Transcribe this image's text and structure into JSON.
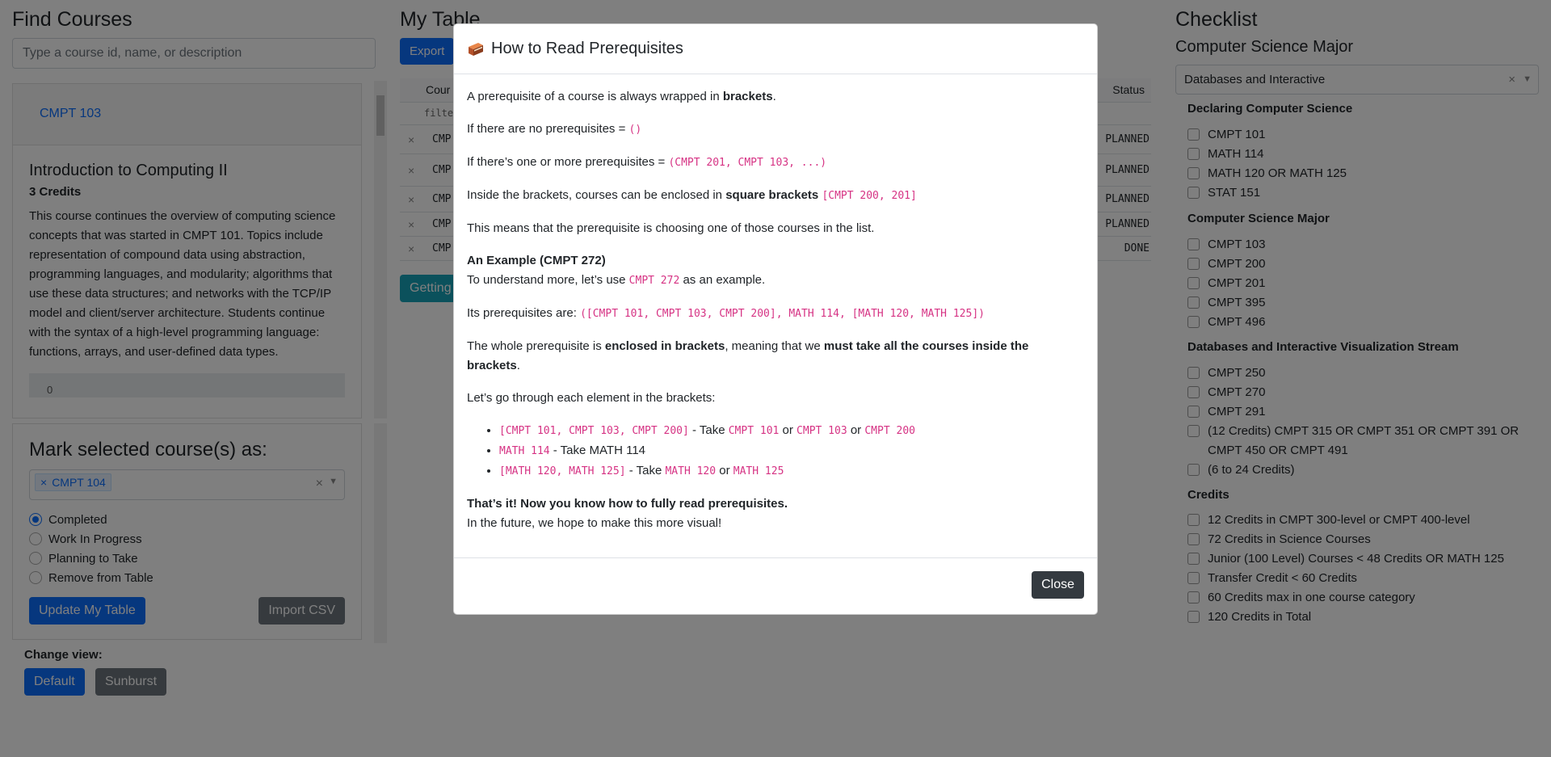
{
  "find_courses": {
    "title": "Find Courses",
    "search_placeholder": "Type a course id, name, or description",
    "course_link": "CMPT 103",
    "course_name": "Introduction to Computing II",
    "course_credits": "3 Credits",
    "course_description": "This course continues the overview of computing science concepts that was started in CMPT 101. Topics include representation of compound data using abstraction, programming languages, and modularity; algorithms that use these data structures; and networks with the TCP/IP model and client/server architecture. Students continue with the syntax of a high-level programming language: functions, arrays, and user-defined data types.",
    "course_footer_value": "0"
  },
  "mark_panel": {
    "title": "Mark selected course(s) as:",
    "chip": "CMPT 104",
    "chip_remove": "×",
    "clear": "×",
    "options": [
      "Completed",
      "Work In Progress",
      "Planning to Take",
      "Remove from Table"
    ],
    "selected_index": 0,
    "update_label": "Update My Table",
    "import_label": "Import CSV"
  },
  "change_view": {
    "label": "Change view:",
    "default_label": "Default",
    "sunburst_label": "Sunburst"
  },
  "my_table": {
    "title": "My Table",
    "export_label": "Export",
    "col_course": "Cour",
    "col_status": "Status",
    "filter_text": "filte",
    "row_remove": "×",
    "rows": [
      {
        "course": "CMP",
        "status": "PLANNED"
      },
      {
        "course": "CMP",
        "status": "PLANNED"
      },
      {
        "course": "CMP",
        "status": "PLANNED"
      },
      {
        "course": "CMP",
        "status": "PLANNED"
      },
      {
        "course": "CMP",
        "status": "DONE"
      }
    ],
    "getting_started_label": "Getting"
  },
  "checklist": {
    "title": "Checklist",
    "major": "Computer Science Major",
    "stream_select": "Databases and Interactive",
    "clear": "×",
    "groups": [
      {
        "title": "Declaring Computer Science",
        "items": [
          "CMPT 101",
          "MATH 114",
          "MATH 120 OR MATH 125",
          "STAT 151"
        ]
      },
      {
        "title": "Computer Science Major",
        "items": [
          "CMPT 103",
          "CMPT 200",
          "CMPT 201",
          "CMPT 395",
          "CMPT 496"
        ]
      },
      {
        "title": "Databases and Interactive Visualization Stream",
        "items": [
          "CMPT 250",
          "CMPT 270",
          "CMPT 291",
          "(12 Credits) CMPT 315 OR CMPT 351 OR CMPT 391 OR CMPT 450 OR CMPT 491",
          "(6 to 24 Credits)"
        ]
      },
      {
        "title": "Credits",
        "items": [
          "12 Credits in CMPT 300-level or CMPT 400-level",
          "72 Credits in Science Courses",
          "Junior (100 Level) Courses < 48 Credits OR MATH 125",
          "Transfer Credit < 60 Credits",
          "60 Credits max in one course category",
          "120 Credits in Total"
        ]
      }
    ]
  },
  "modal": {
    "icon": "book-icon",
    "title": "How to Read Prerequisites",
    "p1_text": "A prerequisite of a course is always wrapped in ",
    "p1_bold": "brackets",
    "p1_end": ".",
    "p2_text": "If there are no prerequisites = ",
    "p2_code": "()",
    "p3_text": "If there’s one or more prerequisites = ",
    "p3_code": "(CMPT 201, CMPT 103, ...)",
    "p4_text": "Inside the brackets, courses can be enclosed in ",
    "p4_bold": "square brackets",
    "p4_code": "[CMPT 200, 201]",
    "p5_text": "This means that the prerequisite is choosing one of those courses in the list.",
    "example_heading": "An Example (CMPT 272)",
    "p6_text": "To understand more, let’s use ",
    "p6_code": "CMPT 272",
    "p6_end": " as an example.",
    "p7_text": "Its prerequisites are: ",
    "p7_code": "([CMPT 101, CMPT 103, CMPT 200], MATH 114, [MATH 120, MATH 125])",
    "p8_text": "The whole prerequisite is ",
    "p8_bold1": "enclosed in brackets",
    "p8_mid": ", meaning that we ",
    "p8_bold2": "must take all the courses inside the brackets",
    "p8_end": ".",
    "p9_text": "Let’s go through each element in the brackets:",
    "li1_code": "[CMPT 101, CMPT 103, CMPT 200]",
    "li1_text": " - Take ",
    "li1_c1": "CMPT 101",
    "li1_or1": " or ",
    "li1_c2": "CMPT 103",
    "li1_or2": " or ",
    "li1_c3": "CMPT 200",
    "li2_code": "MATH 114",
    "li2_text": " - Take MATH 114",
    "li3_code": "[MATH 120, MATH 125]",
    "li3_text": " - Take ",
    "li3_c1": "MATH 120",
    "li3_or": " or ",
    "li3_c2": "MATH 125",
    "closing_bold": "That’s it! Now you know how to fully read prerequisites.",
    "closing_text": "In the future, we hope to make this more visual!",
    "close_label": "Close"
  }
}
